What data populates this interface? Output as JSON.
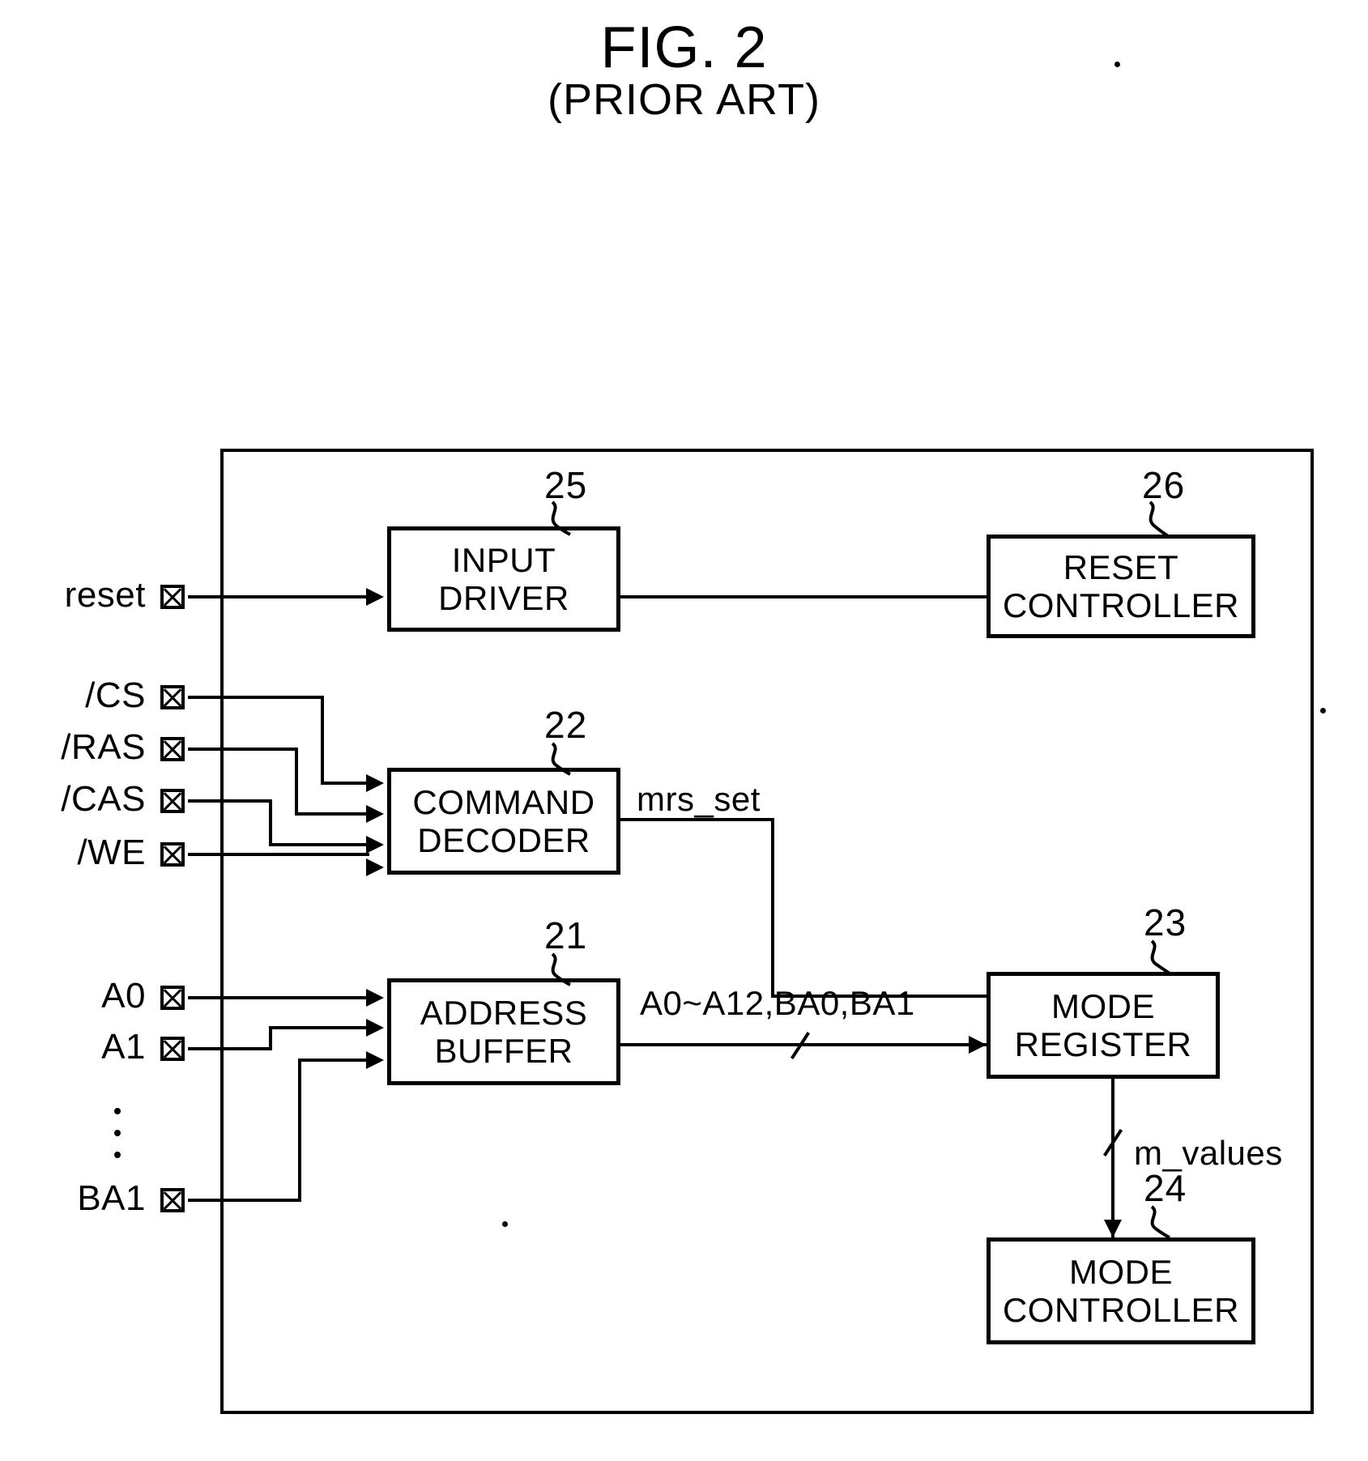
{
  "figure": {
    "title": "FIG. 2",
    "subtitle": "(PRIOR ART)"
  },
  "pins": [
    {
      "label": "reset"
    },
    {
      "label": "/CS"
    },
    {
      "label": "/RAS"
    },
    {
      "label": "/CAS"
    },
    {
      "label": "/WE"
    },
    {
      "label": "A0"
    },
    {
      "label": "A1"
    },
    {
      "label": "BA1"
    }
  ],
  "blocks": [
    {
      "ref": "25",
      "line1": "INPUT",
      "line2": "DRIVER"
    },
    {
      "ref": "26",
      "line1": "RESET",
      "line2": "CONTROLLER"
    },
    {
      "ref": "22",
      "line1": "COMMAND",
      "line2": "DECODER"
    },
    {
      "ref": "21",
      "line1": "ADDRESS",
      "line2": "BUFFER"
    },
    {
      "ref": "23",
      "line1": "MODE",
      "line2": "REGISTER"
    },
    {
      "ref": "24",
      "line1": "MODE",
      "line2": "CONTROLLER"
    }
  ],
  "signals": {
    "mrs_set": "mrs_set",
    "address_bus": "A0~A12,BA0,BA1",
    "m_values": "m_values"
  },
  "colors": {
    "ink": "#000000",
    "paper": "#ffffff"
  }
}
